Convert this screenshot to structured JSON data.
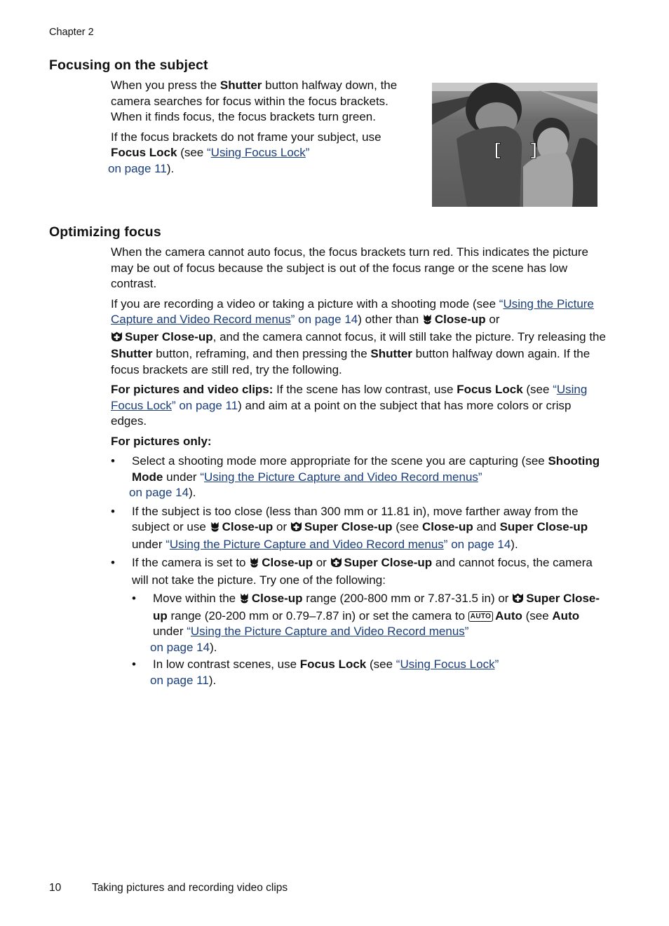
{
  "header": {
    "chapter": "Chapter 2"
  },
  "section1": {
    "heading": "Focusing on the subject",
    "p1": {
      "a": "When you press the ",
      "b1": "Shutter",
      "c": " button halfway down, the camera searches for focus within the focus brackets. When it finds focus, the focus brackets turn green."
    },
    "p2": {
      "a": "If the focus brackets do not frame your subject, use ",
      "b1": "Focus Lock",
      "c": " (see ",
      "link_q1": "“",
      "link_text": "Using Focus Lock",
      "link_q2": "”",
      "link_page": " on page 11",
      "d": ")."
    },
    "image": {
      "alt": "Two boys standing on a street with focus brackets displayed between them",
      "bracket_left": "[",
      "bracket_right": "]"
    }
  },
  "section2": {
    "heading": "Optimizing focus",
    "p1": "When the camera cannot auto focus, the focus brackets turn red. This indicates the picture may be out of focus because the subject is out of the focus range or the scene has low contrast.",
    "p2": {
      "a": "If you are recording a video or taking a picture with a shooting mode (see ",
      "link_q1": "“",
      "link_text": "Using the Picture Capture and Video Record menus",
      "link_q2": "”",
      "link_page": " on page 14",
      "b": ") other than ",
      "closeup": "Close-up",
      "c": " or ",
      "superclose": "Super Close-up",
      "d": ", and the camera cannot focus, it will still take the picture. Try releasing the ",
      "shutter1": "Shutter",
      "e": " button, reframing, and then pressing the ",
      "shutter2": "Shutter",
      "f": " button halfway down again. If the focus brackets are still red, try the following."
    },
    "p3": {
      "label": "For pictures and video clips:",
      "a": " If the scene has low contrast, use ",
      "focuslock": "Focus Lock",
      "b": " (see ",
      "link_q1": "“",
      "link_text": "Using Focus Lock",
      "link_q2": "”",
      "link_page": " on page 11",
      "c": ") and aim at a point on the subject that has more colors or crisp edges."
    },
    "pictures_only_label": "For pictures only:",
    "bullets": [
      {
        "a": "Select a shooting mode more appropriate for the scene you are capturing (see ",
        "b1": "Shooting Mode",
        "c": " under ",
        "link_q1": "“",
        "link_text": "Using the Picture Capture and Video Record menus",
        "link_q2": "”",
        "link_page": " on page 14",
        "d": ")."
      },
      {
        "a": "If the subject is too close (less than 300 mm or 11.81 in), move farther away from the subject or use ",
        "closeup": "Close-up",
        "b": " or ",
        "superclose": "Super Close-up",
        "c": " (see ",
        "closeup2": "Close-up",
        "d": " and ",
        "superclose2": "Super Close-up",
        "e": " under ",
        "link_q1": "“",
        "link_text": "Using the Picture Capture and Video Record menus",
        "link_q2": "”",
        "link_page": " on page 14",
        "f": ")."
      },
      {
        "a": "If the camera is set to ",
        "closeup": "Close-up",
        "b": " or ",
        "superclose": "Super Close-up",
        "c": " and cannot focus, the camera will not take the picture. Try one of the following:",
        "sub": [
          {
            "a": "Move within the ",
            "closeup": "Close-up",
            "b": " range (200-800 mm or 7.87-31.5 in) or ",
            "superclose": "Super Close-up",
            "c": " range (20-200 mm or 0.79–7.87 in) or set the camera to ",
            "auto_icon": "AUTO",
            "auto": "Auto",
            "d": " (see ",
            "auto2": "Auto",
            "e": " under ",
            "link_q1": "“",
            "link_text": "Using the Picture Capture and Video Record menus",
            "link_q2": "”",
            "link_page": " on page 14",
            "f": ")."
          },
          {
            "a": "In low contrast scenes, use ",
            "focuslock": "Focus Lock",
            "b": " (see ",
            "link_q1": "“",
            "link_text": "Using Focus Lock",
            "link_q2": "”",
            "link_page": " on page 11",
            "c": ")."
          }
        ]
      }
    ]
  },
  "footer": {
    "page_number": "10",
    "title": "Taking pictures and recording video clips"
  },
  "colors": {
    "link": "#1a3e7a",
    "text": "#111111"
  }
}
